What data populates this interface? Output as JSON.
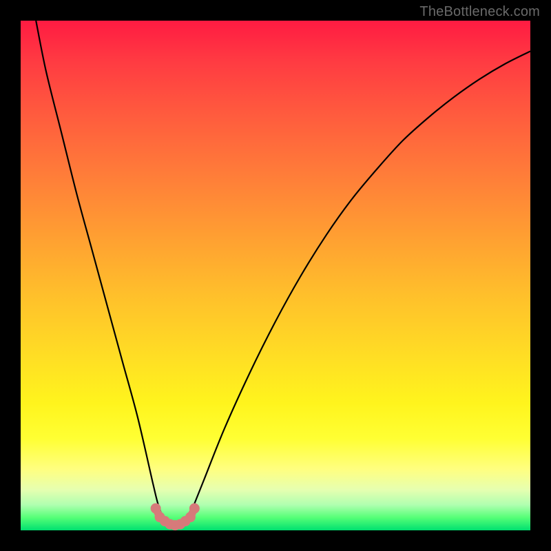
{
  "watermark": "TheBottleneck.com",
  "chart_data": {
    "type": "line",
    "title": "",
    "xlabel": "",
    "ylabel": "",
    "xlim": [
      0,
      100
    ],
    "ylim": [
      0,
      100
    ],
    "grid": false,
    "legend": false,
    "series": [
      {
        "name": "bottleneck-curve",
        "x": [
          3,
          5,
          8,
          11,
          14,
          17,
          20,
          23,
          26,
          27,
          28,
          29,
          30,
          31,
          32,
          33,
          34,
          36,
          40,
          45,
          50,
          55,
          60,
          65,
          70,
          75,
          80,
          85,
          90,
          95,
          100
        ],
        "y": [
          100,
          90,
          78,
          66,
          55,
          44,
          33,
          22,
          9,
          5,
          2.5,
          1.5,
          1,
          1,
          1.5,
          2.5,
          5,
          10,
          20,
          31,
          41,
          50,
          58,
          65,
          71,
          76.5,
          81,
          85,
          88.5,
          91.5,
          94
        ],
        "color": "#000000"
      },
      {
        "name": "bottom-marker-dots",
        "x": [
          26.5,
          27.3,
          28.3,
          29.3,
          30.3,
          31.3,
          32.3,
          33.3,
          34.1
        ],
        "y": [
          4.3,
          2.6,
          1.8,
          1.2,
          1.0,
          1.2,
          1.8,
          2.6,
          4.3
        ],
        "color": "#d67a7a"
      },
      {
        "name": "bottom-marker-stroke",
        "x": [
          26.5,
          27.3,
          28.3,
          29.3,
          30.3,
          31.3,
          32.3,
          33.3,
          34.1
        ],
        "y": [
          4.3,
          2.6,
          1.8,
          1.2,
          1.0,
          1.2,
          1.8,
          2.6,
          4.3
        ],
        "color": "#d67a7a"
      }
    ]
  }
}
